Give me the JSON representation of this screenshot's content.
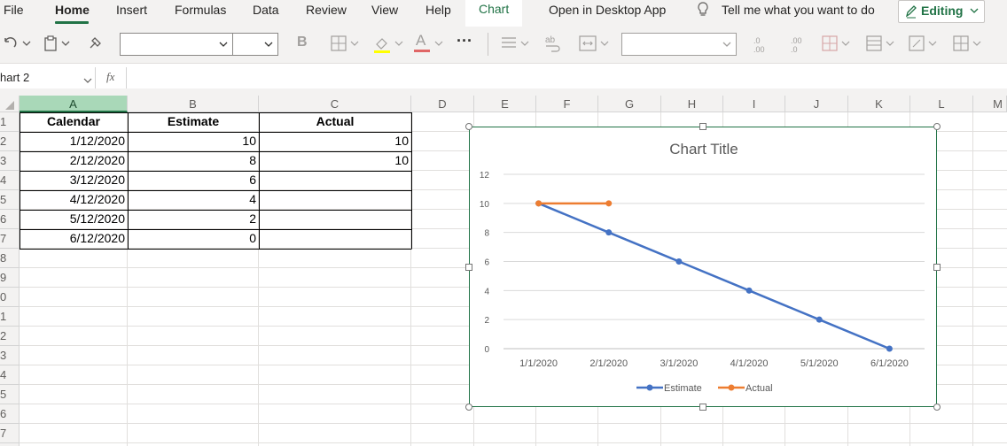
{
  "menu": {
    "items": [
      "File",
      "Home",
      "Insert",
      "Formulas",
      "Data",
      "Review",
      "View",
      "Help"
    ],
    "chart_tab": "Chart",
    "open_desktop": "Open in Desktop App",
    "tell_me": "Tell me what you want to do",
    "editing": "Editing"
  },
  "toolbar": {
    "bold": "B",
    "more": "···",
    "font_color_letter": "A",
    "accent": "#217346",
    "font_color": "#e06666",
    "fill_color": "#ffff00"
  },
  "formula_bar": {
    "name_box": "hart 2",
    "fx": "fx",
    "value": ""
  },
  "columns": [
    "A",
    "B",
    "C",
    "D",
    "E",
    "F",
    "G",
    "H",
    "I",
    "J",
    "K",
    "L",
    "M"
  ],
  "rows": [
    "1",
    "2",
    "3",
    "4",
    "5",
    "6",
    "7",
    "8",
    "9",
    "0",
    "1",
    "2",
    "3",
    "4",
    "5",
    "6",
    "7"
  ],
  "table": {
    "headers": [
      "Calendar",
      "Estimate",
      "Actual"
    ],
    "rows": [
      [
        "1/12/2020",
        "10",
        "10"
      ],
      [
        "2/12/2020",
        "8",
        "10"
      ],
      [
        "3/12/2020",
        "6",
        ""
      ],
      [
        "4/12/2020",
        "4",
        ""
      ],
      [
        "5/12/2020",
        "2",
        ""
      ],
      [
        "6/12/2020",
        "0",
        ""
      ]
    ]
  },
  "chart_data": {
    "type": "line",
    "title": "Chart Title",
    "categories": [
      "1/1/2020",
      "2/1/2020",
      "3/1/2020",
      "4/1/2020",
      "5/1/2020",
      "6/1/2020"
    ],
    "y_ticks": [
      "0",
      "2",
      "4",
      "6",
      "8",
      "10",
      "12"
    ],
    "ylim": [
      0,
      12
    ],
    "grid": true,
    "legend": "bottom",
    "series": [
      {
        "name": "Estimate",
        "color": "#4472c4",
        "values": [
          10,
          8,
          6,
          4,
          2,
          0
        ]
      },
      {
        "name": "Actual",
        "color": "#ed7d31",
        "values": [
          10,
          10,
          null,
          null,
          null,
          null
        ]
      }
    ]
  }
}
